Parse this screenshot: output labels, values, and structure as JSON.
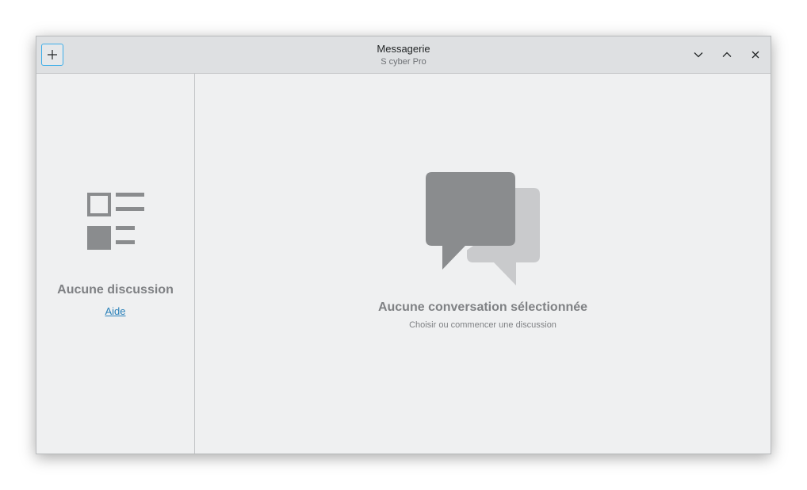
{
  "window": {
    "title": "Messagerie",
    "subtitle": "S cyber Pro"
  },
  "titlebar": {
    "new_icon": "plus-icon",
    "minimize_icon": "chevron-down-icon",
    "maximize_icon": "chevron-up-icon",
    "close_icon": "close-icon"
  },
  "sidebar": {
    "placeholder_icon": "list-icon",
    "empty_title": "Aucune discussion",
    "help_link": "Aide"
  },
  "main": {
    "placeholder_icon": "chat-bubbles-icon",
    "empty_title": "Aucune conversation sélectionnée",
    "empty_subtitle": "Choisir ou commencer une discussion"
  },
  "colors": {
    "accent": "#3daee9",
    "link": "#2980b9",
    "placeholder": "#7f8184",
    "background": "#eff0f1",
    "titlebar": "#dee0e2"
  }
}
